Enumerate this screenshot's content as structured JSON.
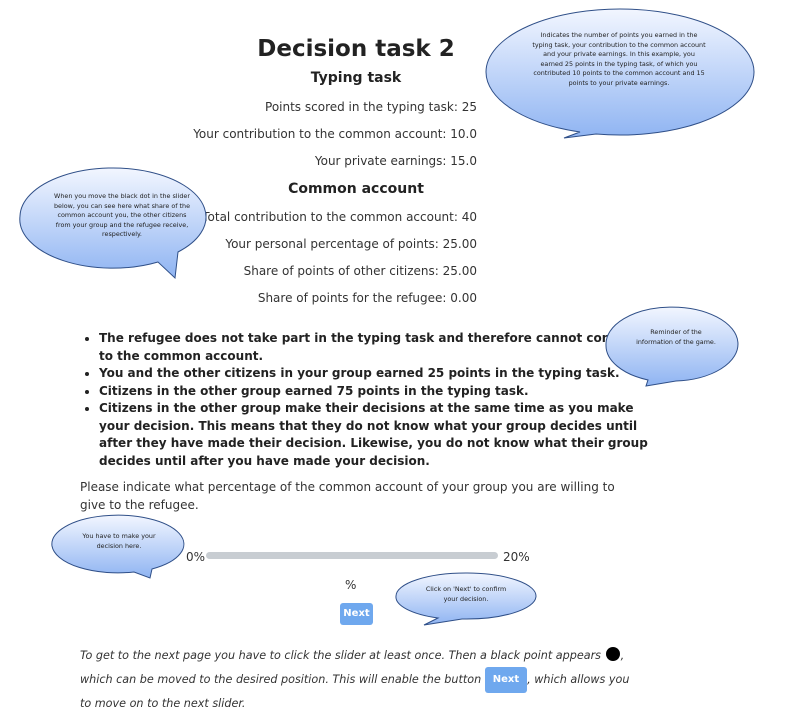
{
  "page": {
    "title": "Decision task 2",
    "typing": {
      "heading": "Typing task",
      "points_label": "Points scored in the typing task: 25",
      "contribution_label": "Your contribution to the common account: 10.0",
      "earnings_label": "Your private earnings: 15.0"
    },
    "common": {
      "heading": "Common account",
      "total_label": "Total contribution to the common account: 40",
      "personal_label": "Your personal percentage of points: 25.00",
      "others_label": "Share of points of other citizens: 25.00",
      "refugee_label": "Share of points for the refugee: 0.00"
    },
    "bullets": [
      "The refugee does not take part in the typing task and therefore cannot contribute to the common account.",
      "You and the other citizens in your group earned 25 points in the typing task.",
      "Citizens in the other group earned 75 points in the typing task.",
      "Citizens in the other group make their decisions at the same time as you make your decision. This means that they do not know what your group decides until after they have made their decision. Likewise, you do not know what their group decides until after you have made your decision."
    ],
    "prompt": "Please indicate what percentage of the common account of your group you are willing to give to the refugee.",
    "slider": {
      "min_label": "0%",
      "max_label": "20%",
      "percent_unit": "%"
    },
    "next_button": "Next",
    "instructions": {
      "part1": "To get to the next page you have to click the slider at least once. Then a black point appears",
      "part2": ", which can be moved to the desired position. This will enable the button",
      "button": "Next",
      "part3": ", which allows you to move on to the next slider."
    }
  },
  "callouts": {
    "earnings": "Indicates the number of points you earned in the typing task, your contribution to the common account and your private earnings. In this example, you earned 25 points in the typing task, of which you contributed 10 points to the common account and 15 points to your private earnings.",
    "slider_share": "When you move the black dot in the slider below, you can see here what share of the common account you, the other citizens from your group and the refugee receive, respectively.",
    "reminder": "Reminder of the information of the game.",
    "decision": "You have to make your decision here.",
    "next": "Click on 'Next' to confirm your decision."
  },
  "colors": {
    "bubble_top": "#f2f6ff",
    "bubble_bottom": "#8fb4f2",
    "bubble_stroke": "#2f4f88",
    "button": "#6fa8ee",
    "slider_track": "#c8cdd2"
  }
}
